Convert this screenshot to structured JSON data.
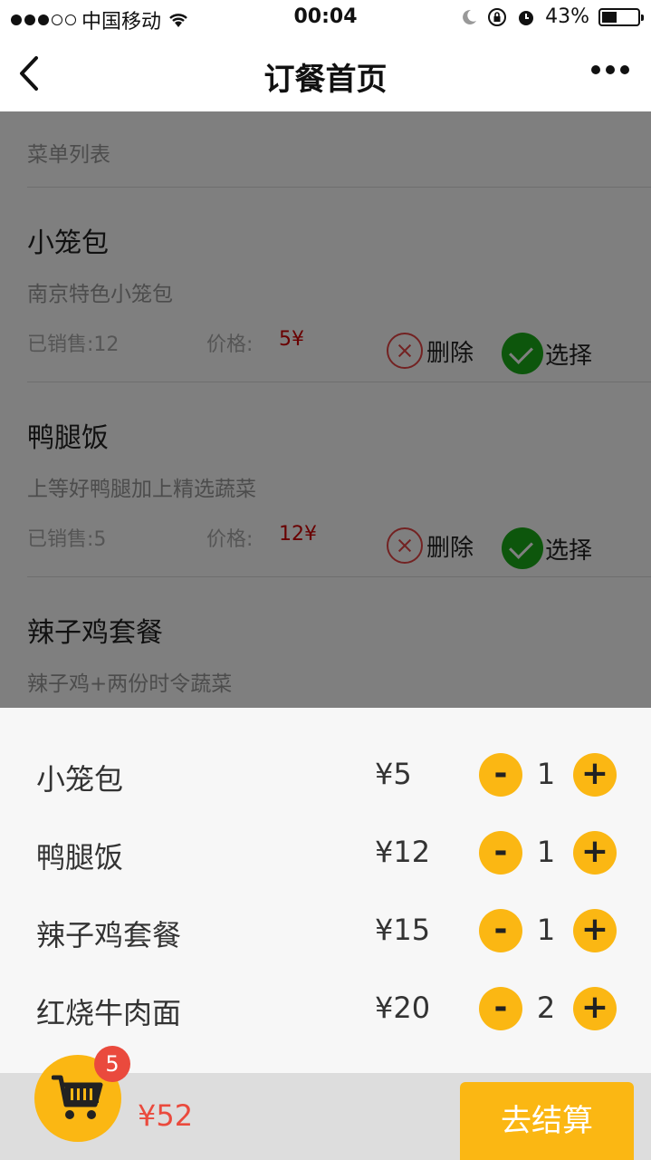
{
  "status": {
    "carrier": "中国移动",
    "time": "00:04",
    "battery": "43%",
    "battery_level": 0.43
  },
  "nav": {
    "title": "订餐首页"
  },
  "menu": {
    "header": "菜单列表",
    "sold_label": "已销售:",
    "price_label": "价格:",
    "delete_label": "删除",
    "select_label": "选择",
    "dishes": [
      {
        "name": "小笼包",
        "desc": "南京特色小笼包",
        "sold": "12",
        "price": "5¥"
      },
      {
        "name": "鸭腿饭",
        "desc": "上等好鸭腿加上精选蔬菜",
        "sold": "5",
        "price": "12¥"
      },
      {
        "name": "辣子鸡套餐",
        "desc": "辣子鸡+两份时令蔬菜"
      }
    ]
  },
  "cart": {
    "items": [
      {
        "name": "小笼包",
        "price": "¥5",
        "qty": "1"
      },
      {
        "name": "鸭腿饭",
        "price": "¥12",
        "qty": "1"
      },
      {
        "name": "辣子鸡套餐",
        "price": "¥15",
        "qty": "1"
      },
      {
        "name": "红烧牛肉面",
        "price": "¥20",
        "qty": "2"
      }
    ],
    "minus": "-",
    "plus": "+",
    "badge_count": "5",
    "total": "¥52",
    "checkout_label": "去结算"
  },
  "colors": {
    "accent": "#fbb713",
    "price_red": "#d30000",
    "badge_red": "#ea4a3d",
    "select_green": "#1aad19"
  }
}
